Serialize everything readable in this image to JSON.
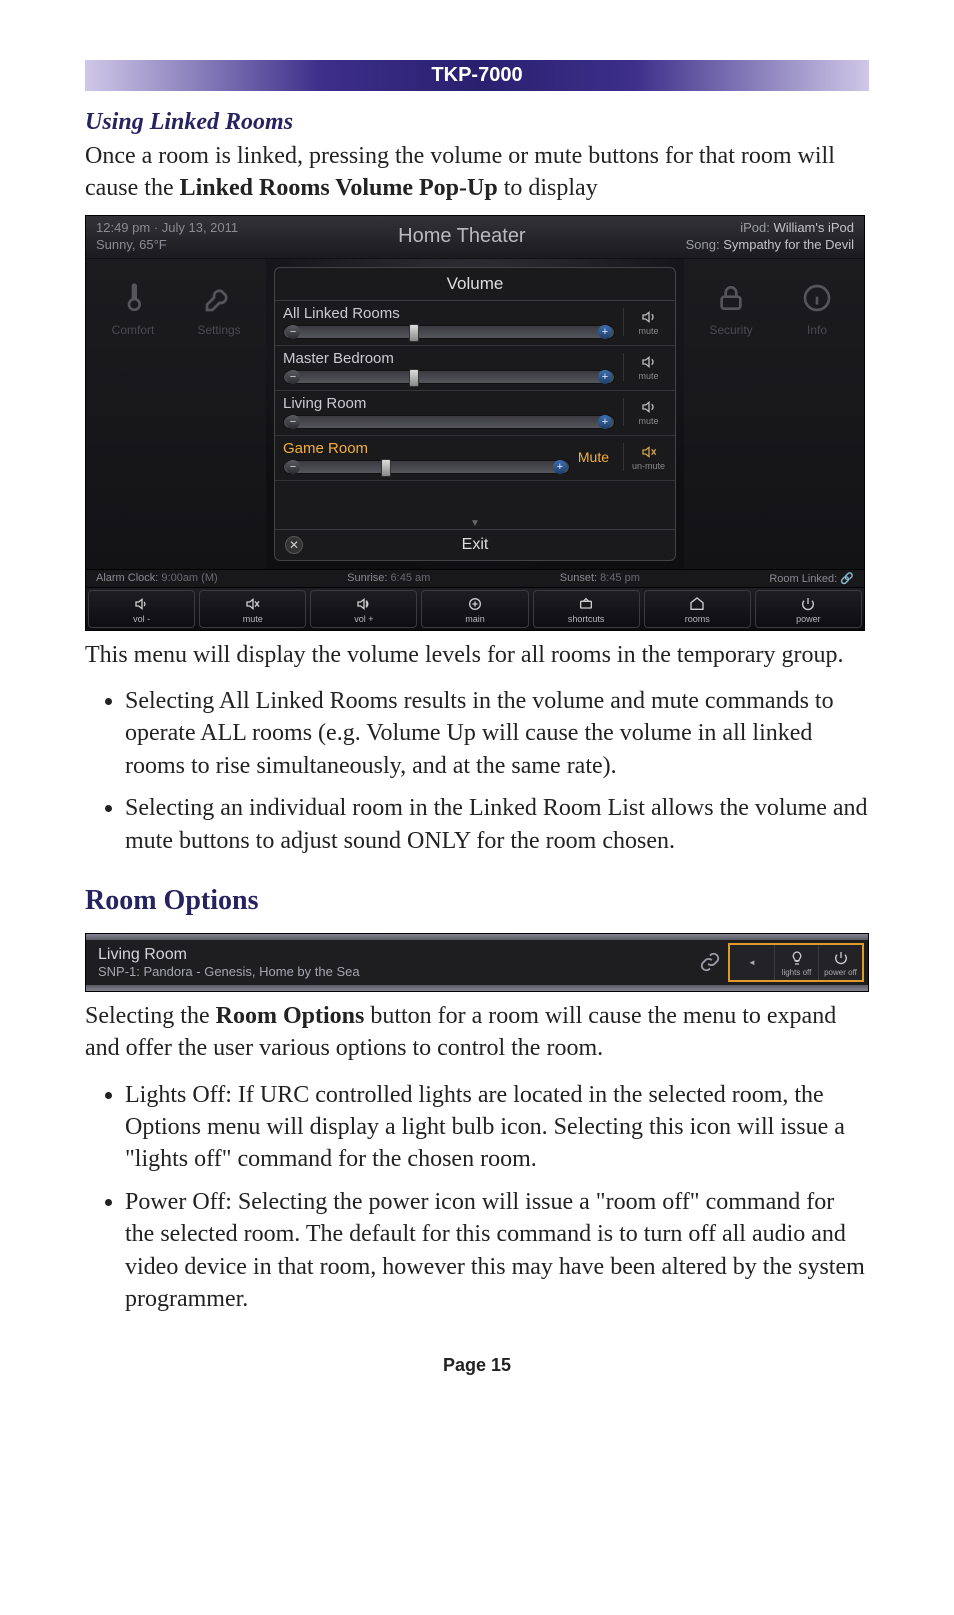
{
  "header": {
    "product": "TKP-7000"
  },
  "subsection_title": "Using Linked Rooms",
  "intro_pre": "Once a room is linked, pressing the volume or mute buttons for that room will cause the ",
  "intro_bold": "Linked Rooms Volume Pop-Up",
  "intro_post": " to display",
  "scr1": {
    "top": {
      "time_date": "12:49 pm · July 13, 2011",
      "weather": "Sunny, 65°F",
      "title": "Home Theater",
      "device_label": "iPod:",
      "device_value": "William's iPod",
      "song_label": "Song:",
      "song_value": "Sympathy for the Devil"
    },
    "left_tiles": {
      "comfort": "Comfort",
      "settings": "Settings"
    },
    "right_tiles": {
      "security": "Security",
      "info": "Info"
    },
    "popup": {
      "title": "Volume",
      "rows": [
        {
          "name": "All Linked Rooms",
          "mute_label": "mute",
          "thumb": 22,
          "muted": false
        },
        {
          "name": "Master Bedroom",
          "mute_label": "mute",
          "thumb": 22,
          "muted": false
        },
        {
          "name": "Living Room",
          "mute_label": "mute",
          "thumb": 0,
          "muted": false,
          "noslider": true
        },
        {
          "name": "Game Room",
          "mute_label": "un-mute",
          "mute_text": "Mute",
          "thumb": 18,
          "muted": true,
          "selected": true
        }
      ],
      "exit": "Exit"
    },
    "status": {
      "alarm_label": "Alarm Clock:",
      "alarm_value": "9:00am (M)",
      "sunrise_label": "Sunrise:",
      "sunrise_value": "6:45 am",
      "sunset_label": "Sunset:",
      "sunset_value": "8:45 pm",
      "roomlinked": "Room Linked:"
    },
    "bottom": [
      {
        "id": "vol-minus",
        "label": "vol -"
      },
      {
        "id": "mute",
        "label": "mute"
      },
      {
        "id": "vol-plus",
        "label": "vol +"
      },
      {
        "id": "main",
        "label": "main"
      },
      {
        "id": "shortcuts",
        "label": "shortcuts"
      },
      {
        "id": "rooms",
        "label": "rooms"
      },
      {
        "id": "power",
        "label": "power"
      }
    ]
  },
  "after_scr1": "This menu will display the volume levels for all rooms in the temporary group.",
  "bullets_a": {
    "b1_pre": "Selecting ",
    "b1_bold": "All Linked Rooms",
    "b1_post": " results in the volume and mute commands to operate ALL rooms (e.g. Volume Up will cause the volume in all linked rooms to rise simultaneously, and at the same rate).",
    "b2_pre": "Selecting an individual room in the ",
    "b2_bold": "Linked Room List",
    "b2_post": " allows the volume and mute buttons to adjust sound ONLY for the room chosen."
  },
  "section_title": "Room Options",
  "scr2": {
    "room": "Living Room",
    "nowplaying": "SNP-1: Pandora - Genesis, Home by the Sea",
    "buttons": {
      "collapse": "◄",
      "lights": "lights off",
      "power": "power off"
    }
  },
  "after_scr2_pre": "Selecting the ",
  "after_scr2_bold": "Room Options",
  "after_scr2_post": " button for a room will cause the menu to expand and offer the user various options to control the room.",
  "bullets_b": {
    "b1_bold": "Lights Off",
    "b1_post": ": If URC controlled lights are located in the selected room, the Options menu will display a light bulb icon. Selecting this icon will issue a \"lights off\" command for the chosen room.",
    "b2_bold": "Power Off",
    "b2_post": ": Selecting the power icon will issue a \"room off\" command for the selected room. The default for this command is to turn off all audio and video device in that room, however this may have been altered by the system programmer."
  },
  "page": "Page 15"
}
